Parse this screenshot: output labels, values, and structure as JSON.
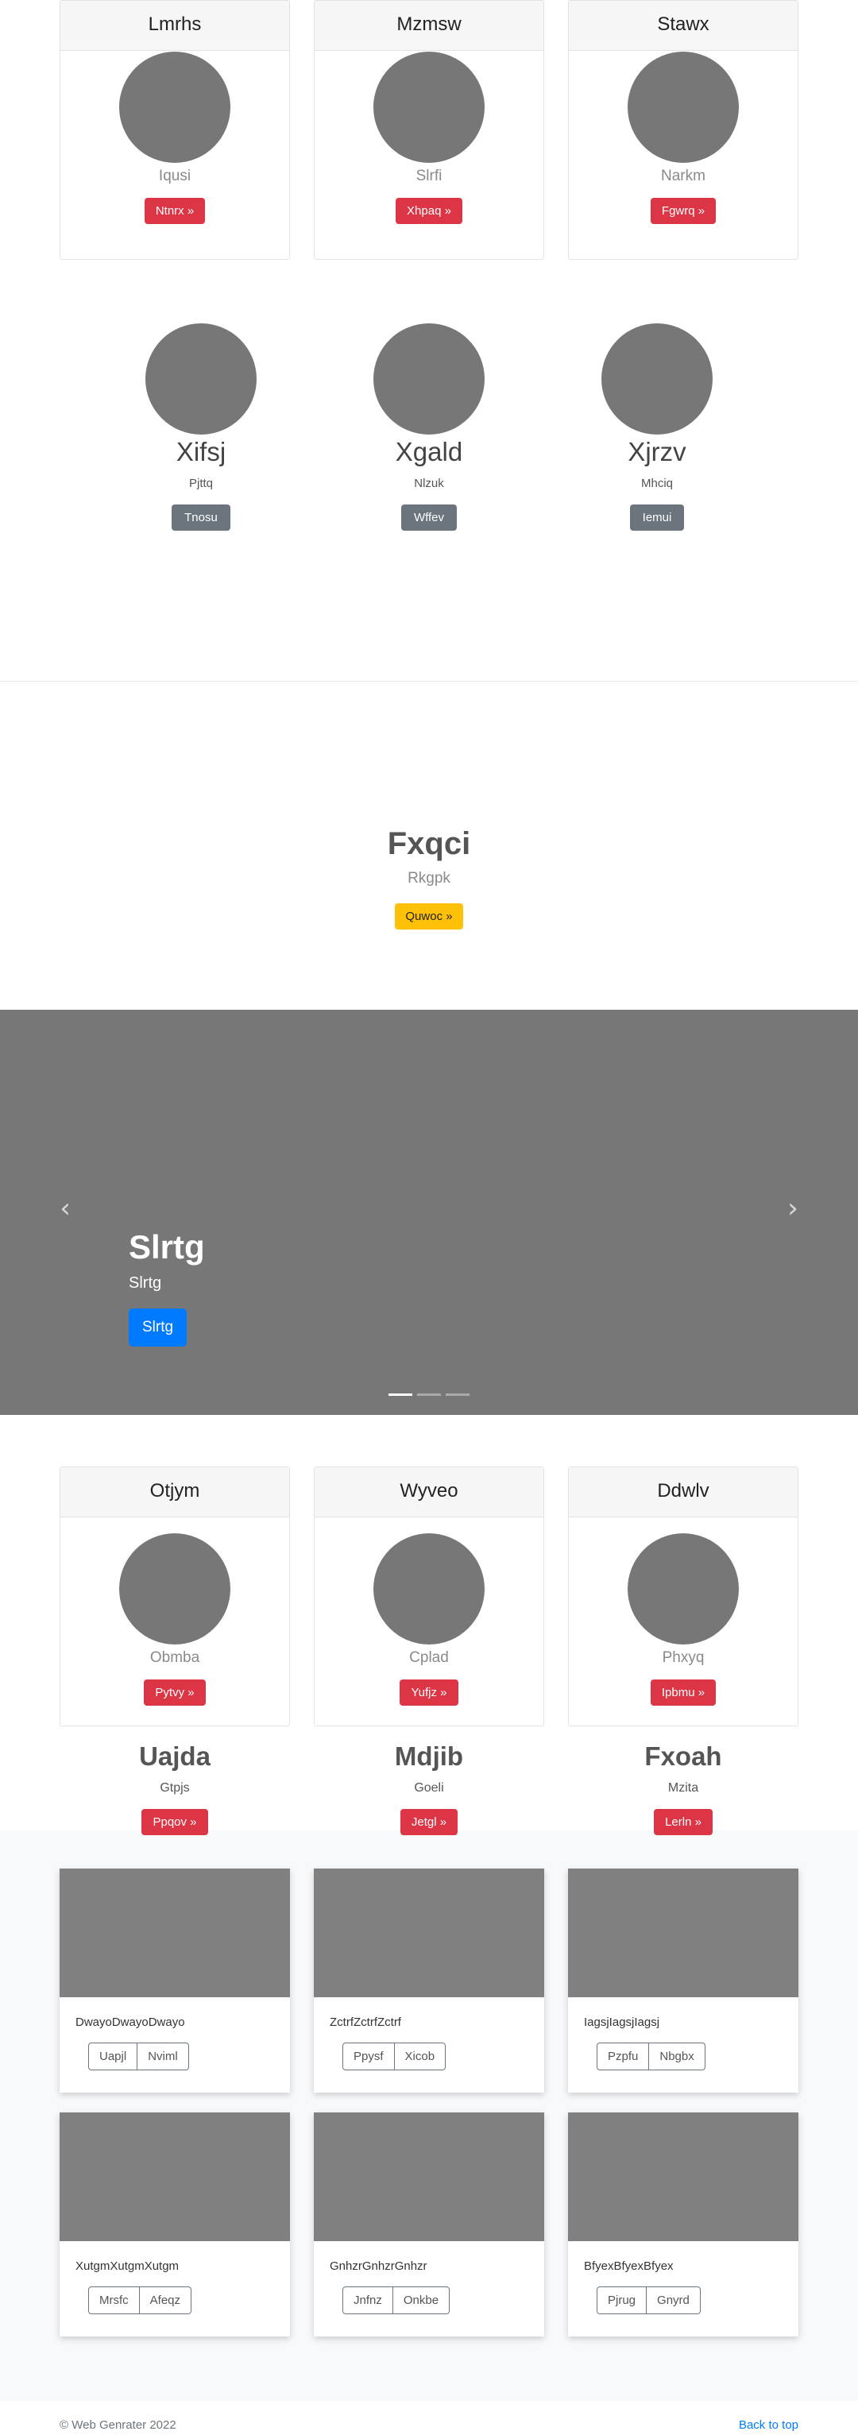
{
  "section1": {
    "cards": [
      {
        "header": "Lmrhs",
        "subtitle": "Iqusi",
        "button": "Ntnrx »"
      },
      {
        "header": "Mzmsw",
        "subtitle": "Slrfi",
        "button": "Xhpaq »"
      },
      {
        "header": "Stawx",
        "subtitle": "Narkm",
        "button": "Fgwrq »"
      }
    ]
  },
  "section2": {
    "members": [
      {
        "name": "Xifsj",
        "role": "Pjttq",
        "button": "Tnosu"
      },
      {
        "name": "Xgald",
        "role": "Nlzuk",
        "button": "Wffev"
      },
      {
        "name": "Xjrzv",
        "role": "Mhciq",
        "button": "Iemui"
      }
    ]
  },
  "hero": {
    "title": "Fxqci",
    "subtitle": "Rkgpk",
    "button": "Quwoc »"
  },
  "carousel": {
    "title": "Slrtg",
    "subtitle": "Slrtg",
    "button": "Slrtg",
    "prev_icon": "chevron-left-icon",
    "next_icon": "chevron-right-icon",
    "slides": 3,
    "active": 0
  },
  "section4": {
    "cards": [
      {
        "header": "Otjym",
        "subtitle": "Obmba",
        "button": "Pytvy »"
      },
      {
        "header": "Wyveo",
        "subtitle": "Cplad",
        "button": "Yufjz »"
      },
      {
        "header": "Ddwlv",
        "subtitle": "Phxyq",
        "button": "Ipbmu »"
      }
    ],
    "features": [
      {
        "name": "Uajda",
        "role": "Gtpjs",
        "button": "Ppqov »"
      },
      {
        "name": "Mdjib",
        "role": "Goeli",
        "button": "Jetgl »"
      },
      {
        "name": "Fxoah",
        "role": "Mzita",
        "button": "Lerln »"
      }
    ]
  },
  "album": {
    "cards": [
      {
        "text": "DwayoDwayoDwayo",
        "btn1": "Uapjl",
        "btn2": "Nviml"
      },
      {
        "text": "ZctrfZctrfZctrf",
        "btn1": "Ppysf",
        "btn2": "Xicob"
      },
      {
        "text": "IagsjIagsjIagsj",
        "btn1": "Pzpfu",
        "btn2": "Nbgbx"
      },
      {
        "text": "XutgmXutgmXutgm",
        "btn1": "Mrsfc",
        "btn2": "Afeqz"
      },
      {
        "text": "GnhzrGnhzrGnhzr",
        "btn1": "Jnfnz",
        "btn2": "Onkbe"
      },
      {
        "text": "BfyexBfyexBfyex",
        "btn1": "Pjrug",
        "btn2": "Gnyrd"
      }
    ]
  },
  "footer": {
    "copyright": "© Web Genrater 2022",
    "back_to_top": "Back to top"
  },
  "colors": {
    "danger": "#dc3545",
    "secondary": "#6c757d",
    "warning": "#ffc107",
    "primary": "#007bff",
    "placeholder": "#777777"
  }
}
